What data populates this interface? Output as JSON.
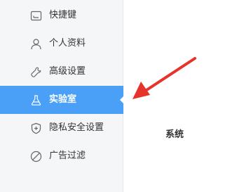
{
  "sidebar": {
    "items": [
      {
        "label": "快捷键",
        "icon": "keyboard-icon"
      },
      {
        "label": "个人资料",
        "icon": "user-icon"
      },
      {
        "label": "高级设置",
        "icon": "wrench-icon"
      },
      {
        "label": "实验室",
        "icon": "flask-icon",
        "active": true
      },
      {
        "label": "隐私安全设置",
        "icon": "shield-plus-icon"
      },
      {
        "label": "广告过滤",
        "icon": "block-icon"
      }
    ]
  },
  "main": {
    "section_label": "系统"
  },
  "colors": {
    "active_bg": "#4a9ff7",
    "sidebar_bg": "#f5f6f8",
    "annotation_arrow": "#e8332d"
  }
}
